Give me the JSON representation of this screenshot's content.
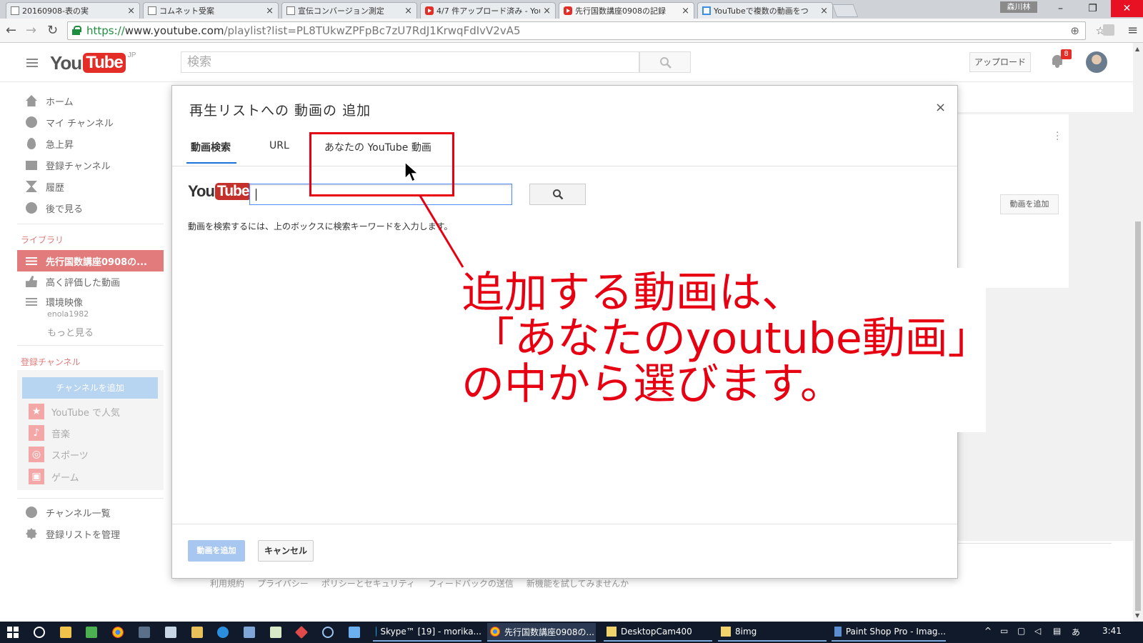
{
  "browser": {
    "tabs": [
      {
        "title": "20160908-表の実",
        "favicon": "page-icon",
        "active": false
      },
      {
        "title": "コムネット受案",
        "favicon": "page-icon",
        "active": false
      },
      {
        "title": "宣伝コンバージョン測定",
        "favicon": "page-icon",
        "active": false
      },
      {
        "title": "4/7 件アップロード済み - You",
        "favicon": "youtube-icon",
        "active": false
      },
      {
        "title": "先行国数講座0908の記録",
        "favicon": "youtube-icon",
        "active": true
      },
      {
        "title": "YouTubeで複数の動画をつ",
        "favicon": "blue-icon",
        "active": false
      }
    ],
    "window_user_label": "森川林",
    "url_scheme": "https://",
    "url_host": "www.youtube.com",
    "url_rest": "/playlist?list=PL8TUkwZPFpBc7zU7RdJ1KrwqFdIvV2vA5"
  },
  "masthead": {
    "logo_you": "You",
    "logo_tube": "Tube",
    "logo_region": "JP",
    "search_placeholder": "検索",
    "upload_label": "アップロード",
    "notification_count": "8"
  },
  "guide": {
    "main_items": [
      "ホーム",
      "マイ チャンネル",
      "急上昇",
      "登録チャンネル",
      "履歴",
      "後で見る"
    ],
    "library_heading": "ライブラリ",
    "library_items": [
      {
        "label": "先行国数講座0908の...",
        "selected": true
      },
      {
        "label": "高く評価した動画",
        "selected": false
      },
      {
        "label": "環境映像",
        "selected": false,
        "sub": "enola1982"
      }
    ],
    "more_label": "もっと見る",
    "subs_heading": "登録チャンネル",
    "add_channel_label": "チャンネルを追加",
    "channels": [
      "YouTube で人気",
      "音楽",
      "スポーツ",
      "ゲーム"
    ],
    "bottom_items": [
      "チャンネル一覧",
      "登録リストを管理"
    ]
  },
  "page": {
    "add_video_label": "動画を追加",
    "footer_links": [
      "利用規約",
      "プライバシー",
      "ポリシーとセキュリティ",
      "フィードバックの送信",
      "新機能を試してみませんか"
    ]
  },
  "modal": {
    "title": "再生リストへの 動画の 追加",
    "close_symbol": "×",
    "tabs": [
      "動画検索",
      "URL",
      "あなたの YouTube 動画"
    ],
    "active_tab": 0,
    "logo_you": "You",
    "logo_tube": "Tube",
    "search_value": "",
    "hint": "動画を検索するには、上のボックスに検索キーワードを入力します。",
    "add_button": "動画を追加",
    "cancel_button": "キャンセル"
  },
  "annotation": {
    "lines": [
      "追加する動画は、",
      "「あなたのyoutube動画」",
      "の中から選びます。"
    ],
    "color": "#e60012"
  },
  "taskbar": {
    "tasks": [
      {
        "label": "Skype™ [19] - morika...",
        "icon": "skype-icon"
      },
      {
        "label": "先行国数講座0908の...",
        "icon": "chrome-icon"
      },
      {
        "label": "DesktopCam400",
        "icon": "folder-icon"
      },
      {
        "label": "8img",
        "icon": "folder-icon"
      },
      {
        "label": "Paint Shop Pro - Imag...",
        "icon": "paintshop-icon"
      }
    ],
    "ime": "あ",
    "clock": "3:41"
  },
  "colors": {
    "youtube_red": "#e52d27",
    "selection": "#e27b7b",
    "annotation_red": "#e60012",
    "taskbar": "#101a2a"
  }
}
